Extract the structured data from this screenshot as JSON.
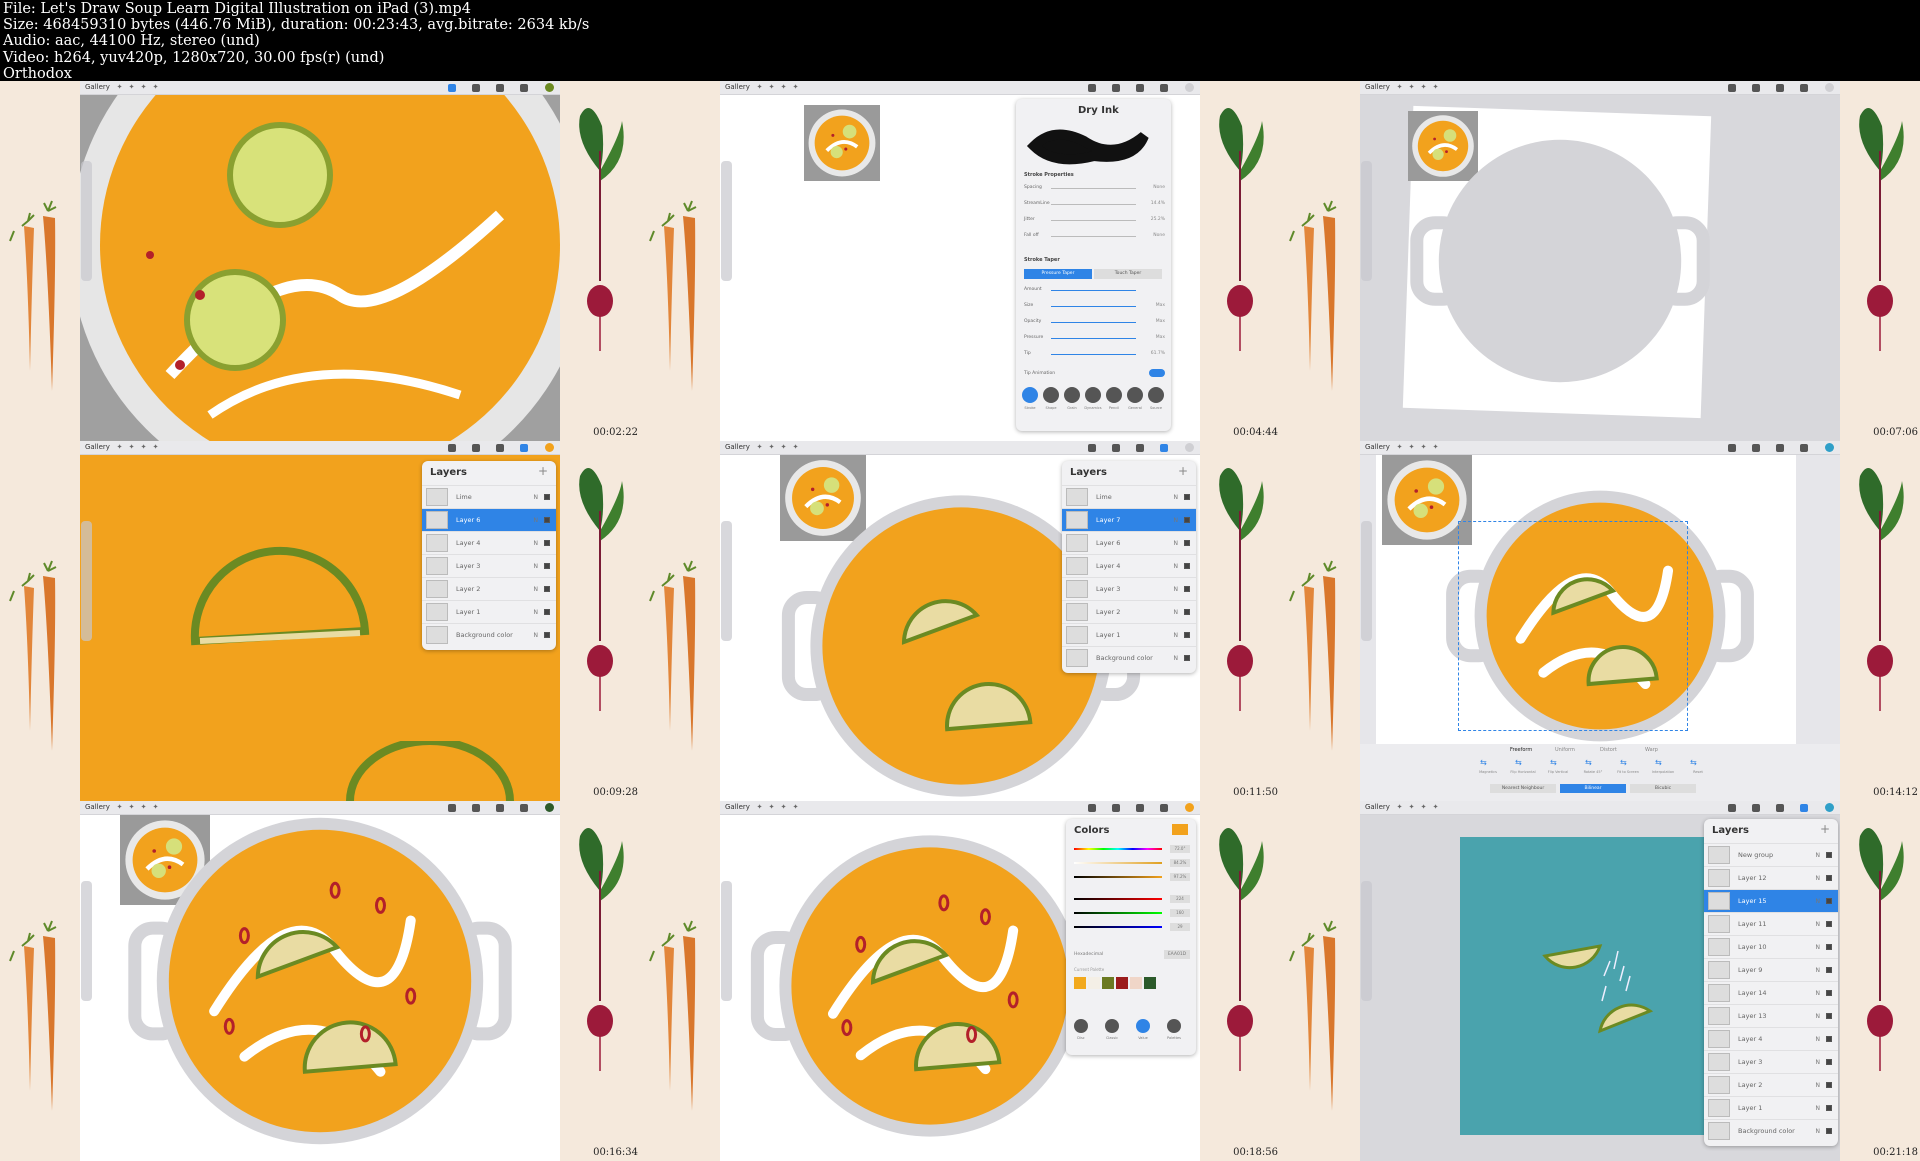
{
  "header": {
    "lines": [
      "File: Let's Draw Soup Learn Digital Illustration on iPad (3).mp4",
      "Size: 468459310 bytes (446.76 MiB), duration: 00:23:43, avg.bitrate: 2634 kb/s",
      "Audio: aac, 44100 Hz, stereo (und)",
      "Video: h264, yuv420p, 1280x720, 30.00 fps(r) (und)",
      "Orthodox"
    ]
  },
  "app": {
    "gallery_label": "Gallery"
  },
  "thumbnails": [
    {
      "timestamp": "00:02:22"
    },
    {
      "timestamp": "00:04:44"
    },
    {
      "timestamp": "00:07:06"
    },
    {
      "timestamp": "00:09:28"
    },
    {
      "timestamp": "00:11:50"
    },
    {
      "timestamp": "00:14:12"
    },
    {
      "timestamp": "00:16:34"
    },
    {
      "timestamp": "00:18:56"
    },
    {
      "timestamp": "00:21:18"
    }
  ],
  "brush_panel": {
    "title": "Dry Ink",
    "section1": "Stroke Properties",
    "props": [
      {
        "label": "Spacing",
        "value": "None"
      },
      {
        "label": "StreamLine",
        "value": "14.4%"
      },
      {
        "label": "Jitter",
        "value": "25.2%"
      },
      {
        "label": "Fall off",
        "value": "None"
      }
    ],
    "section2": "Stroke Taper",
    "taper_tabs": [
      "Pressure Taper",
      "Touch Taper"
    ],
    "taper_props": [
      {
        "label": "Amount",
        "value": ""
      },
      {
        "label": "Size",
        "value": "Max"
      },
      {
        "label": "Opacity",
        "value": "Max"
      },
      {
        "label": "Pressure",
        "value": "Max"
      },
      {
        "label": "Tip",
        "value": "61.7%"
      }
    ],
    "tip_animation": "Tip Animation",
    "bottom_tabs": [
      "Stroke",
      "Shape",
      "Grain",
      "Dynamics",
      "Pencil",
      "General",
      "Source"
    ]
  },
  "layers_panel_1": {
    "title": "Layers",
    "rows": [
      {
        "name": "Lime",
        "selected": false
      },
      {
        "name": "Layer 6",
        "selected": true
      },
      {
        "name": "Layer 4",
        "selected": false
      },
      {
        "name": "Layer 3",
        "selected": false
      },
      {
        "name": "Layer 2",
        "selected": false
      },
      {
        "name": "Layer 1",
        "selected": false
      },
      {
        "name": "Background color",
        "selected": false
      }
    ]
  },
  "layers_panel_2": {
    "title": "Layers",
    "rows": [
      {
        "name": "Lime",
        "selected": false
      },
      {
        "name": "Layer 7",
        "selected": true
      },
      {
        "name": "Layer 6",
        "selected": false
      },
      {
        "name": "Layer 4",
        "selected": false
      },
      {
        "name": "Layer 3",
        "selected": false
      },
      {
        "name": "Layer 2",
        "selected": false
      },
      {
        "name": "Layer 1",
        "selected": false
      },
      {
        "name": "Background color",
        "selected": false
      }
    ]
  },
  "transform_bar": {
    "modes": [
      "Freeform",
      "Uniform",
      "Distort",
      "Warp"
    ],
    "actions": [
      "Magnetics",
      "Flip Horizontal",
      "Flip Vertical",
      "Rotate 45°",
      "Fit to Screen",
      "Interpolation",
      "Reset"
    ],
    "interp": [
      "Nearest Neighbour",
      "Bilinear",
      "Bicubic"
    ]
  },
  "colors_panel": {
    "title": "Colors",
    "values": [
      "72.0°",
      "84.2%",
      "97.2%",
      "224",
      "160",
      "29"
    ],
    "hex_label": "Hexadecimal",
    "hex_value": "EAA01D",
    "palette_label": "Current Palette",
    "palette": [
      "#f2a91d",
      "#f4efe6",
      "#6b7a22",
      "#9b1c1c",
      "#f0d6c8",
      "#2c5a2a"
    ],
    "tabs": [
      "Disc",
      "Classic",
      "Value",
      "Palettes"
    ]
  },
  "layers_panel_3": {
    "title": "Layers",
    "rows": [
      {
        "name": "New group",
        "selected": false
      },
      {
        "name": "Layer 12",
        "selected": false
      },
      {
        "name": "Layer 15",
        "selected": true
      },
      {
        "name": "Layer 11",
        "selected": false
      },
      {
        "name": "Layer 10",
        "selected": false
      },
      {
        "name": "Layer 9",
        "selected": false
      },
      {
        "name": "Layer 14",
        "selected": false
      },
      {
        "name": "Layer 13",
        "selected": false
      },
      {
        "name": "Layer 4",
        "selected": false
      },
      {
        "name": "Layer 3",
        "selected": false
      },
      {
        "name": "Layer 2",
        "selected": false
      },
      {
        "name": "Layer 1",
        "selected": false
      },
      {
        "name": "Background color",
        "selected": false
      }
    ]
  },
  "colors": {
    "soup": "#f2a21d",
    "lime": "#e9dca3",
    "rind": "#6b8a22",
    "pot": "#d4d4d8",
    "teal": "#4aa3ad",
    "accent": "#2f84e6"
  }
}
